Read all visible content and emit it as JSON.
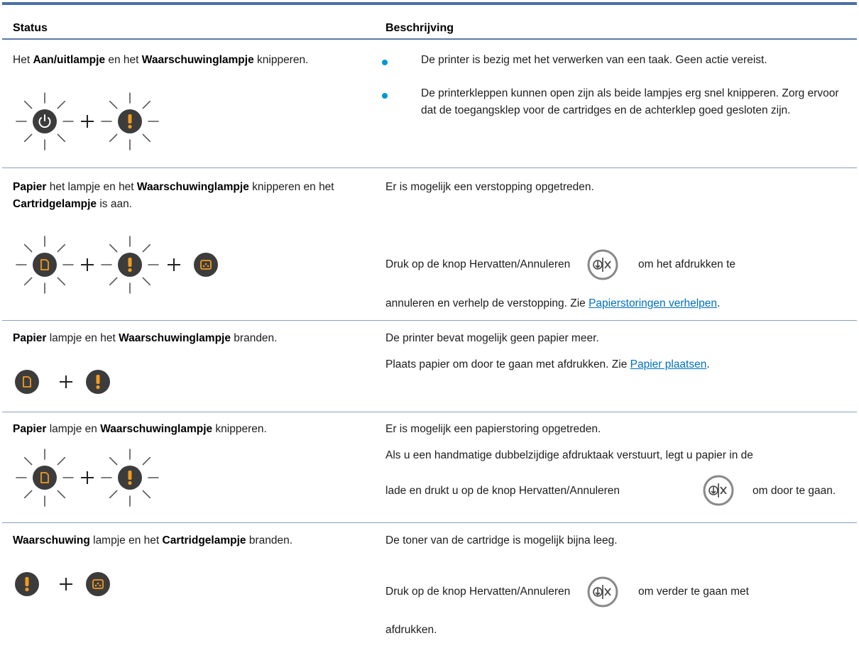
{
  "header": {
    "status": "Status",
    "description": "Beschrijving"
  },
  "rows": [
    {
      "status": [
        {
          "t": "Het ",
          "b": false
        },
        {
          "t": "Aan/uitlampje",
          "b": true
        },
        {
          "t": " en het ",
          "b": false
        },
        {
          "t": "Waarschuwinglampje",
          "b": true
        },
        {
          "t": " knipperen.",
          "b": false
        }
      ],
      "bullets": [
        "De printer is bezig met het verwerken van een taak. Geen actie vereist.",
        "De printerkleppen kunnen open zijn als beide lampjes erg snel knipperen. Zorg ervoor dat de toegangsklep voor de cartridges en de achterklep goed gesloten zijn."
      ]
    },
    {
      "status": [
        {
          "t": "Papier",
          "b": true
        },
        {
          "t": " het lampje en het ",
          "b": false
        },
        {
          "t": "Waarschuwinglampje",
          "b": true
        },
        {
          "t": " knipperen en het ",
          "b": false
        },
        {
          "t": "Cartridgelampje",
          "b": true
        },
        {
          "t": " is aan.",
          "b": false
        }
      ],
      "desc1": "Er is mogelijk een verstopping opgetreden.",
      "desc2_pre": "Druk op de knop Hervatten/Annuleren",
      "desc2_post": "om het afdrukken te",
      "desc3_pre": "annuleren en verhelp de verstopping. Zie ",
      "desc3_link": "Papierstoringen verhelpen",
      "desc3_post": "."
    },
    {
      "status": [
        {
          "t": "Papier",
          "b": true
        },
        {
          "t": " lampje en het ",
          "b": false
        },
        {
          "t": "Waarschuwinglampje",
          "b": true
        },
        {
          "t": " branden.",
          "b": false
        }
      ],
      "desc1": "De printer bevat mogelijk geen papier meer.",
      "desc2_pre": "Plaats papier om door te gaan met afdrukken. Zie ",
      "desc2_link": "Papier plaatsen",
      "desc2_post": "."
    },
    {
      "status": [
        {
          "t": "Papier",
          "b": true
        },
        {
          "t": " lampje en ",
          "b": false
        },
        {
          "t": "Waarschuwinglampje",
          "b": true
        },
        {
          "t": " knipperen.",
          "b": false
        }
      ],
      "desc1": "Er is mogelijk een papierstoring opgetreden.",
      "desc2": "Als u een handmatige dubbelzijdige afdruktaak verstuurt, legt u papier in de",
      "desc3_pre": "lade en drukt u op de knop Hervatten/Annuleren",
      "desc3_post": "om door te gaan."
    },
    {
      "status": [
        {
          "t": "Waarschuwing",
          "b": true
        },
        {
          "t": " lampje en het ",
          "b": false
        },
        {
          "t": "Cartridgelampje",
          "b": true
        },
        {
          "t": " branden.",
          "b": false
        }
      ],
      "desc1": "De toner van de cartridge is mogelijk bijna leeg.",
      "desc2_pre": "Druk op de knop Hervatten/Annuleren",
      "desc2_post": "om verder te gaan met",
      "desc3": "afdrukken."
    }
  ],
  "colors": {
    "accent": "#4a6fa5",
    "lamp_body": "#3c3c3c",
    "lamp_glyph": "#f29b1d",
    "power_glyph": "#ffffff",
    "link": "#0070c0",
    "bullet": "#0096d6"
  },
  "icons": [
    "power-icon",
    "warning-icon",
    "paper-icon",
    "cartridge-icon",
    "resume-cancel-icon",
    "plus-icon",
    "blink-rays"
  ]
}
